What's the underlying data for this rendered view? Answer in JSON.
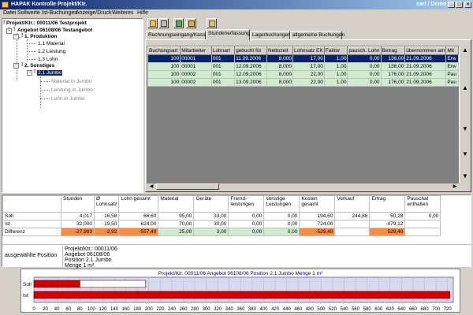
{
  "window": {
    "title": "HAPAK Kontrolle Projekt/Ktr.",
    "user": "carl / Demo",
    "min": "_",
    "max": "□",
    "close": "×"
  },
  "menu": [
    "Datei",
    "Sollwerte",
    "Ist-Buchungen",
    "Anzeige/Druck",
    "Weiteres",
    "Hilfe"
  ],
  "tree": {
    "root": "Projekt/Ktr.: 00011/06 Testprojekt",
    "angebot": "Angebot 06108/06 Testangebot",
    "produktion": "1. Produktion",
    "produktion_items": [
      "1.1 Material",
      "1.2 Leistung",
      "1.3 Lohn"
    ],
    "sonstiges": "2. Sonstiges",
    "jumbo": "2.1 Jumbo",
    "jumbo_items": [
      "Material in Jumbo",
      "Leistung in Jumbo",
      "Lohn in Jumbo"
    ]
  },
  "tabs": [
    "Rechnungseingang/Kasse",
    "Stundenerfassung",
    "Lagerbuchungen",
    "allgemeine Buchungen"
  ],
  "grid": {
    "headers": [
      "Buchungsart",
      "Mitarbeiter",
      "Lohnart",
      "gebucht für",
      "Nettozeit",
      "Lohnsatz EK",
      "Faktor",
      "pausch. Lohn",
      "Betrag",
      "übernommen am",
      "Mit"
    ],
    "rows": [
      [
        "100",
        "00001",
        "001",
        "11.09.2006",
        "8,000",
        "17,00",
        "1,00",
        "0,00",
        "136,00",
        "21.09.2006",
        "Erw"
      ],
      [
        "100",
        "00001",
        "001",
        "12.09.2006",
        "8,000",
        "17,00",
        "1,00",
        "0,00",
        "136,00",
        "21.09.2006",
        "Erw"
      ],
      [
        "100",
        "00002",
        "001",
        "12.09.2006",
        "8,000",
        "22,00",
        "1,00",
        "0,00",
        "176,00",
        "21.09.2006",
        "Pau"
      ],
      [
        "100",
        "00002",
        "001",
        "13.09.2006",
        "8,000",
        "22,00",
        "1,00",
        "0,00",
        "176,00",
        "21.09.2006",
        "Pau"
      ]
    ]
  },
  "summary": {
    "headers": [
      "Stunden",
      "Ø Lohnsatz",
      "Lohn gesamt",
      "Material",
      "Geräte",
      "Fremd-leistungen",
      "sonstige Leistungen",
      "Kosten gesamt",
      "Verkauf",
      "Ertrag",
      "Pauschal enthalten"
    ],
    "rows": [
      {
        "label": "Soll",
        "values": [
          "4,017",
          "16,58",
          "66,60",
          "95,00",
          "33,00",
          "0,00",
          "0,00",
          "194,60",
          "244,88",
          "50,28",
          "0,00"
        ]
      },
      {
        "label": "Ist",
        "values": [
          "32,000",
          "19,50",
          "624,00",
          "70,00",
          "30,00",
          "0,00",
          "0,00",
          "724,00",
          "",
          "-479,12",
          ""
        ]
      },
      {
        "label": "Differenz",
        "values": [
          "-27,983",
          "-2,92",
          "-557,40",
          "25,00",
          "3,00",
          "0,00",
          "0,00",
          "-529,40",
          "",
          "529,40",
          ""
        ]
      }
    ],
    "position_label": "ausgewählte Position",
    "position_lines": [
      "Projekt/Ktr.: 00011/06",
      "Angebot 06108/06",
      "Position 2.1 Jumbo",
      "Menge 1 m²"
    ]
  },
  "chart_data": {
    "type": "bar",
    "orientation": "horizontal",
    "title": "Projekt/Ktr. 00011/06 Angebot 06108/06 Position 2.1 Jumbo Menge 1 m²",
    "categories": [
      "Soll",
      "Ist"
    ],
    "series": [
      {
        "values": [
          80,
          724
        ],
        "color": "#d40000"
      },
      {
        "values": [
          114.6,
          0
        ],
        "color": "#ffffff"
      }
    ],
    "x_ticks": [
      0,
      20,
      40,
      60,
      80,
      100,
      120,
      140,
      160,
      180,
      200,
      220,
      240,
      260,
      280,
      300,
      320,
      340,
      360,
      380,
      400,
      420,
      440,
      460,
      480,
      500,
      520,
      540,
      560,
      580,
      600,
      620,
      640,
      660,
      680,
      700,
      720
    ],
    "xlim": [
      0,
      730
    ],
    "background": "#d8d8f0"
  }
}
